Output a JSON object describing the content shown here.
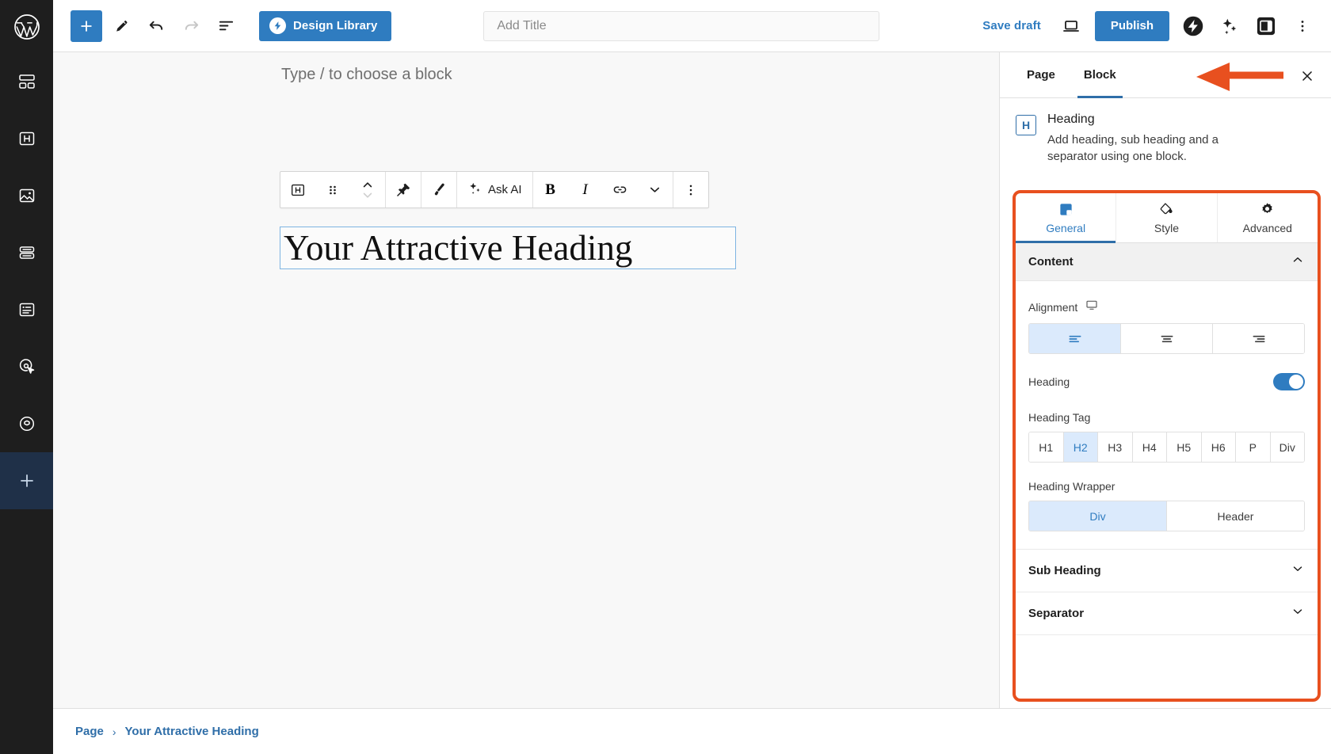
{
  "app": {
    "name": "wordpress-block-editor"
  },
  "rail": {
    "logo": "wordpress-logo",
    "items": [
      {
        "name": "dashboard-icon",
        "label": "Dashboard"
      },
      {
        "name": "heading-block-icon",
        "label": "Heading"
      },
      {
        "name": "image-block-icon",
        "label": "Image"
      },
      {
        "name": "stack-block-icon",
        "label": "Stack"
      },
      {
        "name": "card-block-icon",
        "label": "Card"
      },
      {
        "name": "interaction-icon",
        "label": "Interaction"
      },
      {
        "name": "settings-gear-icon",
        "label": "Settings"
      },
      {
        "name": "add-icon",
        "label": "Add"
      }
    ]
  },
  "toolbar": {
    "add_block_label": "+",
    "tools": [
      {
        "name": "add-block-button",
        "glyph": "+"
      },
      {
        "name": "edit-pen-icon",
        "glyph": "pen"
      },
      {
        "name": "undo-icon",
        "glyph": "undo"
      },
      {
        "name": "redo-icon",
        "glyph": "redo"
      },
      {
        "name": "document-overview-icon",
        "glyph": "list"
      }
    ],
    "design_library_label": "Design Library",
    "save_draft_label": "Save draft",
    "publish_label": "Publish",
    "preview_label": "View",
    "right_icons": [
      {
        "name": "preview-laptop-icon"
      },
      {
        "name": "spectra-bolt-icon"
      },
      {
        "name": "ai-sparkle-icon"
      },
      {
        "name": "settings-sidebar-icon"
      },
      {
        "name": "options-kebab-icon"
      }
    ]
  },
  "title": {
    "placeholder": "Add Title",
    "value": ""
  },
  "canvas": {
    "block_placeholder": "Type / to choose a block",
    "heading_value": "Your Attractive Heading"
  },
  "block_toolbar": {
    "items": [
      {
        "name": "block-type-heading-icon",
        "label": "H"
      },
      {
        "name": "drag-handle-icon",
        "label": ""
      },
      {
        "name": "move-updown-icon",
        "label": ""
      },
      {
        "name": "pin-icon",
        "label": ""
      },
      {
        "name": "brush-icon",
        "label": ""
      },
      {
        "name": "ask-ai-button",
        "label": "Ask AI"
      },
      {
        "name": "bold-button",
        "label": "B"
      },
      {
        "name": "italic-button",
        "label": "I"
      },
      {
        "name": "link-button",
        "label": ""
      },
      {
        "name": "more-rich-text-chevron",
        "label": ""
      },
      {
        "name": "block-options-kebab",
        "label": ""
      }
    ]
  },
  "panel": {
    "tabs": [
      {
        "label": "Page",
        "active": false
      },
      {
        "label": "Block",
        "active": true
      }
    ],
    "close_label": "Close settings",
    "block": {
      "icon_letter": "H",
      "name": "Heading",
      "description": "Add heading, sub heading and a separator using one block."
    },
    "settings_tabs": [
      {
        "label": "General",
        "icon": "layout-square-icon",
        "active": true
      },
      {
        "label": "Style",
        "icon": "paint-bucket-icon",
        "active": false
      },
      {
        "label": "Advanced",
        "icon": "gear-icon",
        "active": false
      }
    ],
    "sections": {
      "content": {
        "title": "Content",
        "expanded": true,
        "alignment": {
          "label": "Alignment",
          "device_icon": "desktop-icon",
          "options": [
            "align-left",
            "align-center",
            "align-right"
          ],
          "selected_index": 0
        },
        "heading_toggle": {
          "label": "Heading",
          "enabled": true
        },
        "heading_tag": {
          "label": "Heading Tag",
          "options": [
            "H1",
            "H2",
            "H3",
            "H4",
            "H5",
            "H6",
            "P",
            "Div"
          ],
          "selected": "H2"
        },
        "heading_wrapper": {
          "label": "Heading Wrapper",
          "options": [
            "Div",
            "Header"
          ],
          "selected": "Div"
        }
      },
      "sub_heading": {
        "title": "Sub Heading",
        "expanded": false
      },
      "separator": {
        "title": "Separator",
        "expanded": false
      }
    }
  },
  "breadcrumb": {
    "items": [
      {
        "label": "Page"
      },
      {
        "label": "Your Attractive Heading"
      }
    ],
    "separator": "›"
  },
  "colors": {
    "accent_blue": "#2f7cc0",
    "annotation_orange": "#e8501f",
    "rail_dark": "#1e1e1e",
    "selected_light_blue": "#dbeafc",
    "green_dot": "#1f7a5c"
  }
}
